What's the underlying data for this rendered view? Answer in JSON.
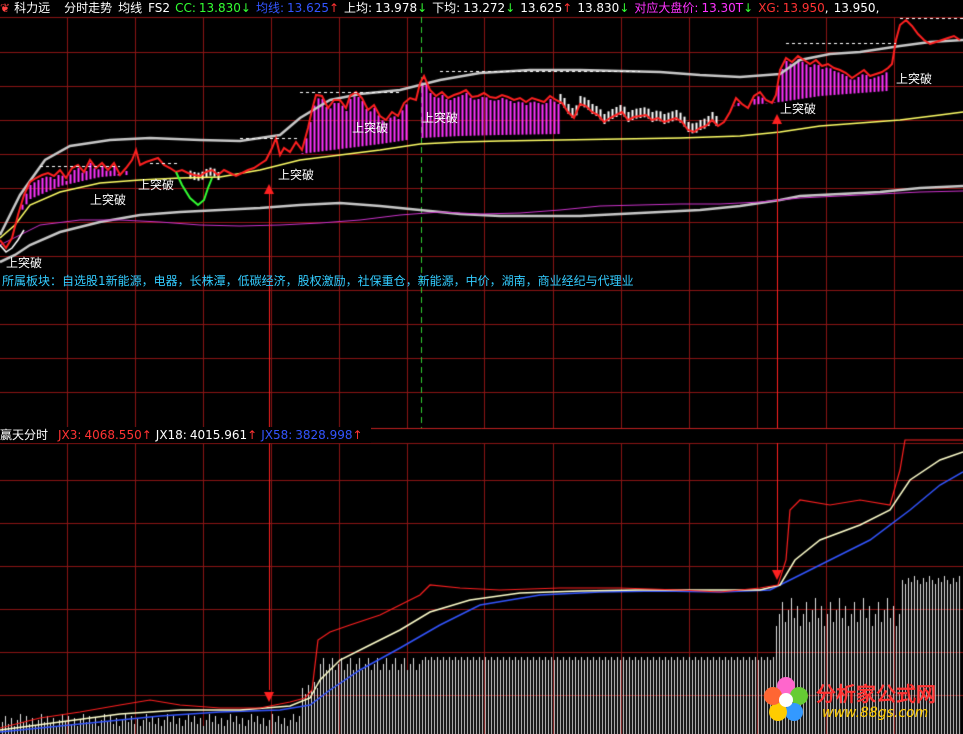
{
  "colors": {
    "bg": "#000000",
    "grid": "#8b1515",
    "price": "#ff2020",
    "avg": "#ffff66",
    "band": "#c0c0c0",
    "magenta_bar": "#ff33ff",
    "jx3": "#ff3333",
    "jx18": "#ffffcc",
    "jx58": "#3355ff"
  },
  "header": {
    "icon": "menu-icon",
    "stock_name": "科力远",
    "view": "分时走势",
    "line_type": "均线",
    "formula": "FS2",
    "cc_label": "CC:",
    "cc_value": "13.830",
    "cc_arrow": "↓",
    "avg_label": "均线:",
    "avg_value": "13.625",
    "avg_arrow": "↑",
    "upper_label": "上均:",
    "upper_value": "13.978",
    "upper_arrow": "↓",
    "lower_label": "下均:",
    "lower_value": "13.272",
    "lower_arrow": "↓",
    "v5": "13.625",
    "v5_arrow": "↑",
    "v6": "13.830",
    "v6_arrow": "↓",
    "index_label": "对应大盘价:",
    "index_value": "13.30T",
    "index_arrow": "↓",
    "xg_label": "XG:",
    "xg_value": "13.950",
    "xg_extra": "13.950,"
  },
  "sector": {
    "text": "所属板块：自选股1新能源，电器，长株潭，低碳经济，股权激励，社保重仓，新能源，中价，湖南，商业经纪与代理业"
  },
  "labels": {
    "breakout": "上突破"
  },
  "lower_header": {
    "title": "赢天分时",
    "jx3_label": "JX3:",
    "jx3_value": "4068.550",
    "jx3_arrow": "↑",
    "jx18_label": "JX18:",
    "jx18_value": "4015.961",
    "jx18_arrow": "↑",
    "jx58_label": "JX58:",
    "jx58_value": "3828.998",
    "jx58_arrow": "↑"
  },
  "watermark": {
    "name": "分析家公式网",
    "url": "www.88gs.com"
  },
  "chart_data": [
    {
      "type": "line",
      "panel": "intraday price",
      "series": [
        {
          "key": "price",
          "points": [
            [
              0,
              13.35
            ],
            [
              3,
              13.3
            ],
            [
              6,
              13.28
            ],
            [
              10,
              13.4
            ],
            [
              14,
              13.46
            ],
            [
              18,
              13.5
            ],
            [
              22,
              13.52
            ],
            [
              26,
              13.55
            ],
            [
              30,
              13.56
            ],
            [
              34,
              13.57
            ],
            [
              38,
              13.55
            ],
            [
              42,
              13.54
            ],
            [
              46,
              13.56
            ],
            [
              50,
              13.58
            ],
            [
              55,
              13.64
            ],
            [
              60,
              13.68
            ],
            [
              64,
              13.7
            ],
            [
              66,
              13.66
            ],
            [
              70,
              13.72
            ],
            [
              75,
              13.74
            ],
            [
              80,
              13.7
            ],
            [
              85,
              13.73
            ],
            [
              90,
              13.76
            ],
            [
              95,
              13.74
            ],
            [
              100,
              13.78
            ],
            [
              105,
              13.76
            ],
            [
              110,
              13.73
            ],
            [
              115,
              13.7
            ],
            [
              120,
              13.72
            ],
            [
              125,
              13.74
            ],
            [
              130,
              13.71
            ],
            [
              135,
              13.7
            ],
            [
              140,
              13.72
            ],
            [
              145,
              13.7
            ],
            [
              150,
              13.68
            ],
            [
              155,
              13.7
            ],
            [
              160,
              13.72
            ],
            [
              165,
              13.75
            ],
            [
              170,
              13.8
            ],
            [
              175,
              13.84
            ],
            [
              180,
              13.88
            ],
            [
              185,
              13.92
            ],
            [
              190,
              13.86
            ],
            [
              195,
              13.82
            ],
            [
              200,
              13.8
            ],
            [
              205,
              13.83
            ],
            [
              210,
              13.85
            ],
            [
              215,
              13.82
            ],
            [
              220,
              13.86
            ],
            [
              225,
              13.9
            ],
            [
              230,
              13.93
            ],
            [
              235,
              13.95
            ],
            [
              240,
              13.92
            ]
          ]
        },
        {
          "key": "avg",
          "points": [
            [
              0,
              13.3
            ],
            [
              10,
              13.4
            ],
            [
              20,
              13.45
            ],
            [
              30,
              13.48
            ],
            [
              40,
              13.5
            ],
            [
              50,
              13.52
            ],
            [
              60,
              13.55
            ],
            [
              66,
              13.58
            ],
            [
              80,
              13.6
            ],
            [
              100,
              13.61
            ],
            [
              120,
              13.62
            ],
            [
              140,
              13.62
            ],
            [
              160,
              13.62
            ],
            [
              180,
              13.63
            ],
            [
              200,
              13.64
            ],
            [
              220,
              13.66
            ],
            [
              240,
              13.68
            ]
          ]
        }
      ]
    },
    {
      "type": "line",
      "panel": "赢天分时",
      "series": [
        {
          "key": "jx3",
          "last": 4068.55
        },
        {
          "key": "jx18",
          "last": 4015.961
        },
        {
          "key": "jx58",
          "last": 3828.998
        }
      ]
    }
  ]
}
